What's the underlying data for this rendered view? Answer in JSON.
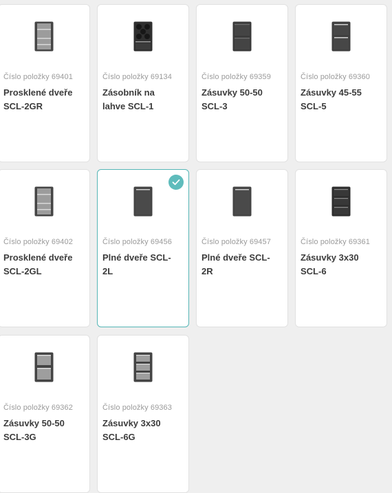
{
  "products": [
    {
      "item_no": "Číslo položky 69401",
      "title": "Prosklené dveře SCL-2GR",
      "icon": "glass-door-cabinet-icon",
      "selected": false
    },
    {
      "item_no": "Číslo položky 69134",
      "title": "Zásobník na lahve SCL-1",
      "icon": "bottle-rack-cabinet-icon",
      "selected": false
    },
    {
      "item_no": "Číslo položky 69359",
      "title": "Zásuvky 50-50 SCL-3",
      "icon": "two-drawer-cabinet-icon",
      "selected": false
    },
    {
      "item_no": "Číslo položky 69360",
      "title": "Zásuvky 45-55 SCL-5",
      "icon": "two-drawer-cabinet-icon",
      "selected": false
    },
    {
      "item_no": "Číslo položky 69402",
      "title": "Prosklené dveře SCL-2GL",
      "icon": "glass-door-cabinet-icon",
      "selected": false
    },
    {
      "item_no": "Číslo položky 69456",
      "title": "Plné dveře SCL-2L",
      "icon": "solid-door-cabinet-icon",
      "selected": true
    },
    {
      "item_no": "Číslo položky 69457",
      "title": "Plné dveře SCL-2R",
      "icon": "solid-door-cabinet-icon",
      "selected": false
    },
    {
      "item_no": "Číslo položky 69361",
      "title": "Zásuvky 3x30 SCL-6",
      "icon": "three-drawer-cabinet-icon",
      "selected": false
    },
    {
      "item_no": "Číslo položky 69362",
      "title": "Zásuvky 50-50 SCL-3G",
      "icon": "two-glass-drawer-cabinet-icon",
      "selected": false
    },
    {
      "item_no": "Číslo položky 69363",
      "title": "Zásuvky 3x30 SCL-6G",
      "icon": "three-glass-drawer-cabinet-icon",
      "selected": false
    }
  ],
  "selection_icon": "checkmark-icon",
  "colors": {
    "card_background": "#ffffff",
    "page_background": "#efefef",
    "selected_border": "#55b5b5",
    "check_badge": "#5fbcbc",
    "title_text": "#3c3c3c",
    "item_number_text": "#9a9a9a",
    "cabinet_dark": "#3f3f3f"
  }
}
